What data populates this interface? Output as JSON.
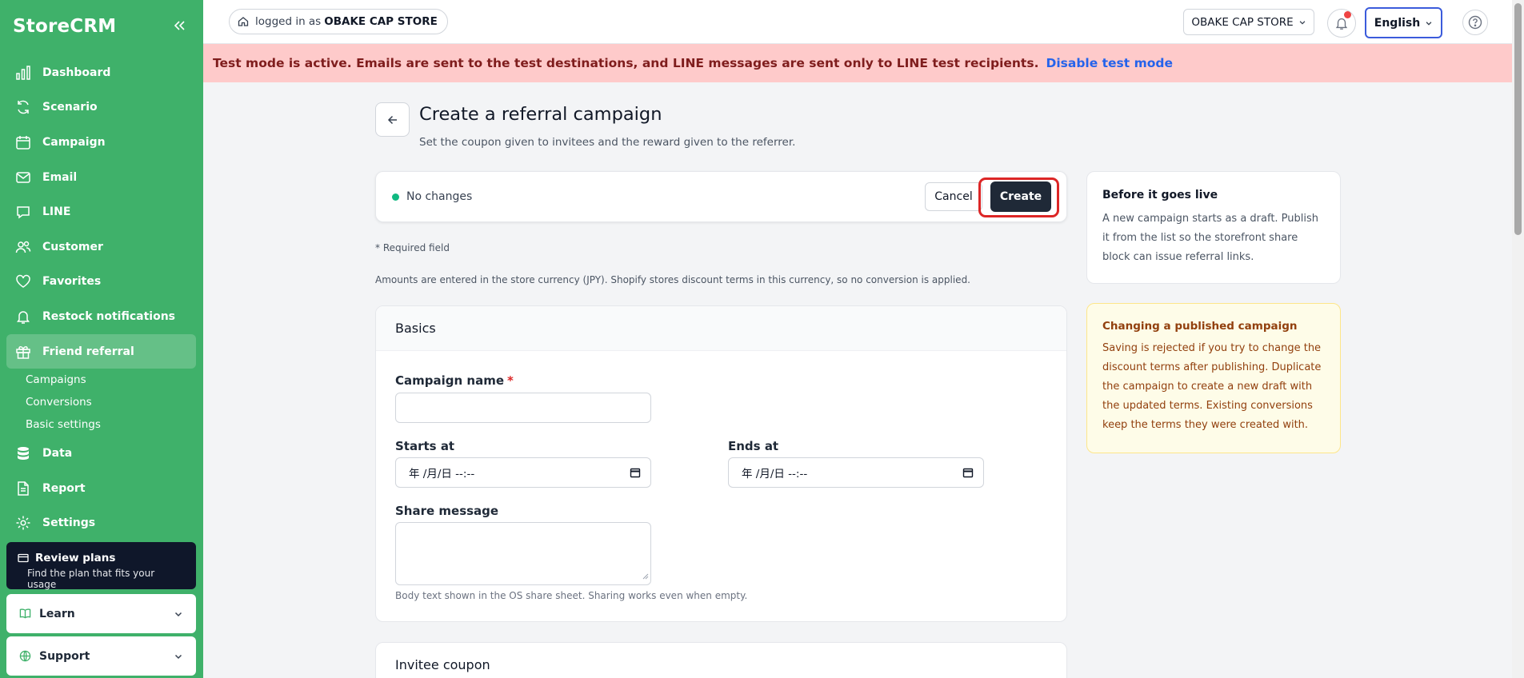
{
  "app": {
    "brand": "StoreCRM"
  },
  "sidebar": {
    "items": [
      {
        "label": "Dashboard",
        "icon": "bar-chart-icon"
      },
      {
        "label": "Scenario",
        "icon": "refresh-icon"
      },
      {
        "label": "Campaign",
        "icon": "calendar-icon"
      },
      {
        "label": "Email",
        "icon": "mail-icon"
      },
      {
        "label": "LINE",
        "icon": "chat-bubble-icon"
      },
      {
        "label": "Customer",
        "icon": "users-icon"
      },
      {
        "label": "Favorites",
        "icon": "heart-icon"
      },
      {
        "label": "Restock notifications",
        "icon": "bell-icon"
      },
      {
        "label": "Friend referral",
        "icon": "gift-icon"
      }
    ],
    "active": "Friend referral",
    "subitems": [
      "Campaigns",
      "Conversions",
      "Basic settings"
    ],
    "items_after": [
      {
        "label": "Data",
        "icon": "database-icon"
      },
      {
        "label": "Report",
        "icon": "file-icon"
      },
      {
        "label": "Settings",
        "icon": "gear-icon"
      }
    ],
    "plan": {
      "title": "Review plans",
      "subtitle": "Find the plan that fits your usage"
    },
    "learn": "Learn",
    "support": "Support"
  },
  "topbar": {
    "logged_in_prefix": "logged in as",
    "store_name": "OBAKE CAP STORE",
    "store_selector": "OBAKE CAP STORE",
    "language": "English"
  },
  "banner": {
    "message": "Test mode is active. Emails are sent to the test destinations, and LINE messages are sent only to LINE test recipients.",
    "link": "Disable test mode"
  },
  "page": {
    "title": "Create a referral campaign",
    "subtitle": "Set the coupon given to invitees and the reward given to the referrer.",
    "status": "No changes",
    "cancel": "Cancel",
    "create": "Create",
    "required_note": "* Required field",
    "currency_note": "Amounts are entered in the store currency (JPY). Shopify stores discount terms in this currency, so no conversion is applied."
  },
  "basics": {
    "heading": "Basics",
    "campaign_name_label": "Campaign name",
    "required_star": "*",
    "campaign_name_value": "",
    "starts_label": "Starts at",
    "starts_value": "年 /月/日 --:--",
    "ends_label": "Ends at",
    "ends_value": "年 /月/日 --:--",
    "share_label": "Share message",
    "share_value": "",
    "share_help": "Body text shown in the OS share sheet. Sharing works even when empty."
  },
  "invitee": {
    "heading": "Invitee coupon"
  },
  "aside": {
    "live_title": "Before it goes live",
    "live_body": "A new campaign starts as a draft. Publish it from the list so the storefront share block can issue referral links.",
    "published_title": "Changing a published campaign",
    "published_body": "Saving is rejected if you try to change the discount terms after publishing. Duplicate the campaign to create a new draft with the updated terms. Existing conversions keep the terms they were created with."
  },
  "colors": {
    "sidebar": "#3fb16a",
    "banner": "#fecaca",
    "primary": "#1f2937",
    "highlight": "#dc2626"
  }
}
